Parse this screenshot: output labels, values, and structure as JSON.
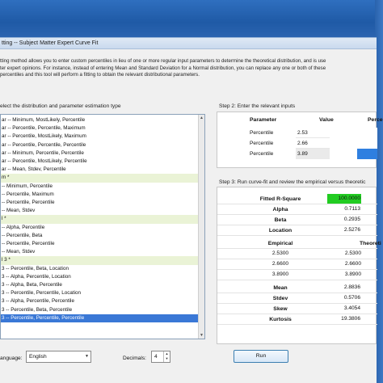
{
  "window": {
    "title": "tting -- Subject Matter Expert Curve Fit"
  },
  "description": {
    "line1": "tting method allows you to enter custom percentiles in lieu of one or more regular input parameters to determine the theoretical distribution, and is use",
    "line2": "ter expert opinions. For instance, instead of entering Mean and Standard Deviation for a Normal distribution, you can replace any one or both of these",
    "line3": "percentiles and this tool will perform a fitting to obtain the relevant distributional parameters."
  },
  "step1": {
    "label": "elect the distribution and parameter estimation type",
    "items": [
      {
        "label": "ar -- Minimum, MostLikely, Percentile",
        "type": "item"
      },
      {
        "label": "ar -- Percentile, Percentile, Maximum",
        "type": "item"
      },
      {
        "label": "ar -- Percentile, MostLikely, Maximum",
        "type": "item"
      },
      {
        "label": "ar -- Percentile, Percentile, Percentile",
        "type": "item"
      },
      {
        "label": "ar -- Minimum, Percentile, Percentile",
        "type": "item"
      },
      {
        "label": "ar -- Percentile, MostLikely, Percentile",
        "type": "item"
      },
      {
        "label": "ar -- Mean, Stdev, Percentile",
        "type": "item"
      },
      {
        "label": "m *",
        "type": "group"
      },
      {
        "label": "-- Minimum, Percentile",
        "type": "item"
      },
      {
        "label": "-- Percentile, Maximum",
        "type": "item"
      },
      {
        "label": "-- Percentile, Percentile",
        "type": "item"
      },
      {
        "label": "-- Mean, Stdev",
        "type": "item"
      },
      {
        "label": "l *",
        "type": "group"
      },
      {
        "label": "-- Alpha, Percentile",
        "type": "item"
      },
      {
        "label": "-- Percentile, Beta",
        "type": "item"
      },
      {
        "label": "-- Percentile, Percentile",
        "type": "item"
      },
      {
        "label": "-- Mean, Stdev",
        "type": "item"
      },
      {
        "label": "l 3 *",
        "type": "group"
      },
      {
        "label": "3 -- Percentile, Beta, Location",
        "type": "item"
      },
      {
        "label": "3 -- Alpha, Percentile, Location",
        "type": "item"
      },
      {
        "label": "3 -- Alpha, Beta, Percentile",
        "type": "item"
      },
      {
        "label": "3 -- Percentile, Percentile, Location",
        "type": "item"
      },
      {
        "label": "3 -- Alpha, Percentile, Percentile",
        "type": "item"
      },
      {
        "label": "3 -- Percentile, Beta, Percentile",
        "type": "item"
      },
      {
        "label": "3 -- Percentile, Percentile, Percentile",
        "type": "selected"
      }
    ]
  },
  "language": {
    "label": "anguage:",
    "value": "English"
  },
  "decimals": {
    "label": "Decimals:",
    "value": "4"
  },
  "step2": {
    "label": "Step 2: Enter the relevant inputs",
    "headers": {
      "parameter": "Parameter",
      "value": "Value",
      "percentile": "Perce"
    },
    "rows": [
      {
        "parameter": "Percentile",
        "value": "2.53"
      },
      {
        "parameter": "Percentile",
        "value": "2.66"
      },
      {
        "parameter": "Percentile",
        "value": "3.89"
      }
    ]
  },
  "step3": {
    "label": "Step 3: Run curve-fit and review the empirical versus theoretic",
    "fitted": {
      "label": "Fitted R-Square",
      "value": "100.0000"
    },
    "params": [
      {
        "label": "Alpha",
        "value": "0.7113"
      },
      {
        "label": "Beta",
        "value": "0.2935"
      },
      {
        "label": "Location",
        "value": "2.5276"
      }
    ],
    "compare_headers": {
      "empirical": "Empirical",
      "theoretical": "Theoreti"
    },
    "compare_rows": [
      {
        "empirical": "2.5300",
        "theoretical": "2.5300"
      },
      {
        "empirical": "2.6600",
        "theoretical": "2.6600"
      },
      {
        "empirical": "3.8900",
        "theoretical": "3.8900"
      }
    ],
    "stats": [
      {
        "label": "Mean",
        "value": "2.8836"
      },
      {
        "label": "Stdev",
        "value": "0.5706"
      },
      {
        "label": "Skew",
        "value": "3.4054"
      },
      {
        "label": "Kurtosis",
        "value": "19.3806"
      }
    ]
  },
  "run_button": {
    "label": "Run"
  },
  "colors": {
    "fitted_highlight": "#22cc22",
    "selected_row": "#3a78d6",
    "group_row": "#eaf3d6",
    "percentile_cell": "#2f7fe0"
  }
}
